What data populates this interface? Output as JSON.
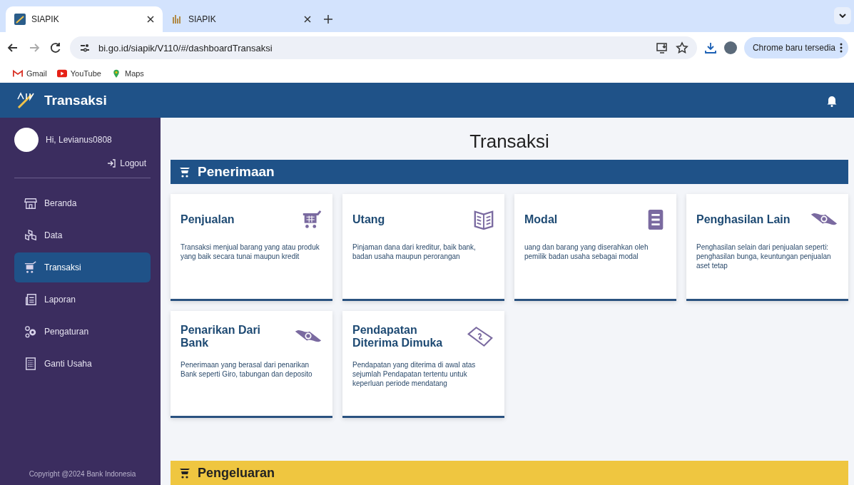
{
  "browser": {
    "tabs": [
      {
        "title": "SIAPIK",
        "selected": true
      },
      {
        "title": "SIAPIK",
        "selected": false
      }
    ],
    "address": "bi.go.id/siapik/V110/#/dashboardTransaksi",
    "update_button": "Chrome baru tersedia",
    "bookmarks": [
      "Gmail",
      "YouTube",
      "Maps"
    ]
  },
  "header": {
    "title": "Transaksi"
  },
  "sidebar": {
    "greeting": "Hi, Levianus0808",
    "logout": "Logout",
    "items": [
      {
        "label": "Beranda",
        "selected": false
      },
      {
        "label": "Data",
        "selected": false
      },
      {
        "label": "Transaksi",
        "selected": true
      },
      {
        "label": "Laporan",
        "selected": false
      },
      {
        "label": "Pengaturan",
        "selected": false
      },
      {
        "label": "Ganti Usaha",
        "selected": false
      }
    ],
    "copyright": "Copyright @2024  Bank Indonesia"
  },
  "page_title": "Transaksi",
  "sections": [
    {
      "title": "Penerimaan",
      "color": "#1f5288",
      "cards": [
        {
          "title": "Penjualan",
          "description": "Transaksi menjual barang yang atau produk yang baik secara tunai maupun kredit"
        },
        {
          "title": "Utang",
          "description": "Pinjaman dana dari kreditur, baik bank, badan usaha maupun perorangan"
        },
        {
          "title": "Modal",
          "description": "uang dan barang yang diserahkan oleh pemilik badan usaha sebagai modal"
        },
        {
          "title": "Penghasilan Lain",
          "description": "Penghasilan selain dari penjualan seperti: penghasilan bunga, keuntungan penjualan aset tetap"
        },
        {
          "title": "Penarikan Dari Bank",
          "description": "Penerimaan yang berasal dari penarikan Bank seperti Giro, tabungan dan deposito"
        },
        {
          "title": "Pendapatan Diterima Dimuka",
          "description": "Pendapatan yang diterima di awal atas sejumlah Pendapatan tertentu untuk keperluan periode mendatang"
        }
      ]
    },
    {
      "title": "Pengeluaran",
      "color": "#efc640"
    }
  ]
}
